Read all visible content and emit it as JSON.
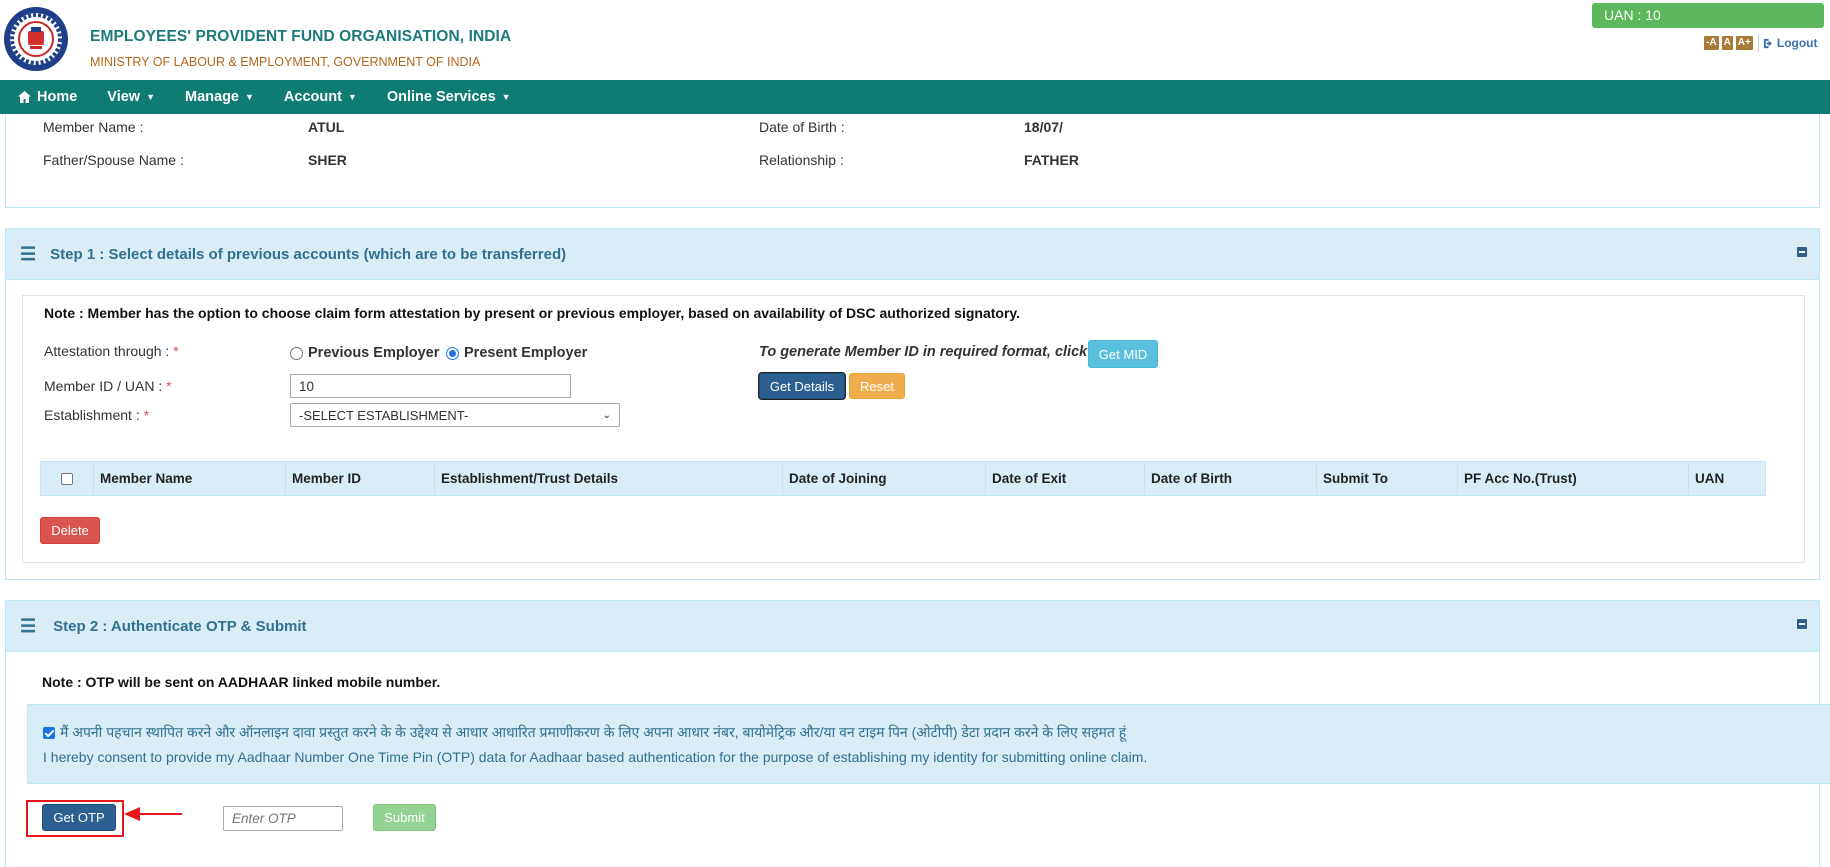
{
  "header": {
    "org_title": "EMPLOYEES' PROVIDENT FUND ORGANISATION, INDIA",
    "org_subtitle": "MINISTRY OF LABOUR & EMPLOYMENT, GOVERNMENT OF INDIA",
    "uan_badge": "UAN : 10",
    "font_controls": [
      "-A",
      "A",
      "A+"
    ],
    "logout_label": "Logout"
  },
  "nav": {
    "items": [
      {
        "label": "Home",
        "icon": "home-icon"
      },
      {
        "label": "View",
        "dropdown": true
      },
      {
        "label": "Manage",
        "dropdown": true
      },
      {
        "label": "Account",
        "dropdown": true
      },
      {
        "label": "Online Services",
        "dropdown": true
      }
    ]
  },
  "member": {
    "name_label": "Member Name :",
    "name_value": "ATUL",
    "dob_label": "Date of Birth :",
    "dob_value": "18/07/",
    "father_label": "Father/Spouse Name :",
    "father_value": "SHER",
    "relationship_label": "Relationship :",
    "relationship_value": "FATHER"
  },
  "step1": {
    "title": "Step 1 : Select details of previous accounts (which are to be transferred)",
    "note": "Note : Member has the option to choose claim form attestation by present or previous employer, based on availability of DSC authorized signatory.",
    "attestation_label": "Attestation through : ",
    "attestation_options": [
      "Previous Employer",
      "Present Employer"
    ],
    "attestation_selected": "Present Employer",
    "member_id_label": "Member ID / UAN : ",
    "member_id_value": "10",
    "establishment_label": "Establishment : ",
    "establishment_selected": "-SELECT ESTABLISHMENT-",
    "generate_text": "To generate Member ID in required format, click",
    "get_mid_label": "Get MID",
    "get_details_label": "Get Details",
    "reset_label": "Reset",
    "required_mark": "*",
    "table_headers": [
      "Member Name",
      "Member ID",
      "Establishment/Trust Details",
      "Date of Joining",
      "Date of Exit",
      "Date of Birth",
      "Submit To",
      "PF Acc No.(Trust)",
      "UAN"
    ],
    "delete_label": "Delete"
  },
  "step2": {
    "title": "Step 2 : Authenticate OTP & Submit",
    "note": "Note : OTP will be sent on AADHAAR linked mobile number.",
    "consent_hindi": "मैं अपनी पहचान स्थापित करने और ऑनलाइन दावा प्रस्तुत करने के के उद्देश्य से आधार आधारित प्रमाणीकरण के लिए अपना आधार नंबर, बायोमेट्रिक और/या वन टाइम पिन (ओटीपी) डेटा प्रदान करने के लिए सहमत हूं",
    "consent_english": "I hereby consent to provide my Aadhaar Number One Time Pin (OTP) data for Aadhaar based authentication for the purpose of establishing my identity for submitting online claim.",
    "consent_checked": true,
    "get_otp_label": "Get OTP",
    "otp_placeholder": "Enter OTP",
    "submit_label": "Submit"
  },
  "colors": {
    "navbar": "#0f7c74",
    "panel_heading": "#d9edf7",
    "primary": "#2e5f91",
    "annotation": "#e8161b"
  }
}
